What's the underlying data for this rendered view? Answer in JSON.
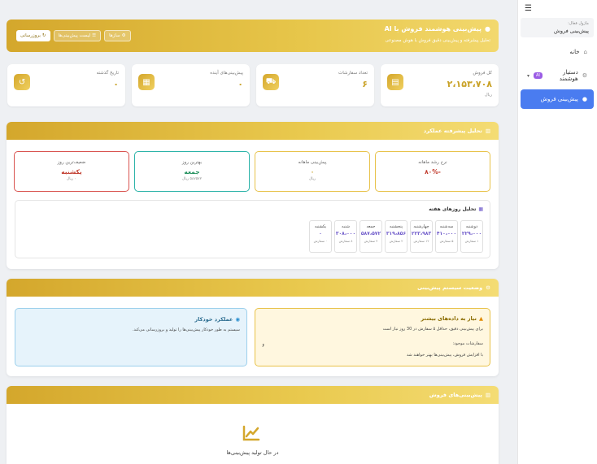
{
  "sidebar": {
    "menu_icon": "☰",
    "crumb_label": "ماژول فعال:",
    "crumb_value": "پیش‌بینی فروش",
    "items": [
      {
        "label": "خانه",
        "icon": "home-icon"
      },
      {
        "label": "دستیار هوشمند",
        "badge": "AI",
        "icon": "gear-icon"
      },
      {
        "label": "پیش‌بینی فروش",
        "icon": "lightbulb-icon"
      }
    ]
  },
  "hero": {
    "title": "پیش‌بینی هوشمند فروش با AI",
    "subtitle": "تحلیل پیشرفته و پیش‌بینی دقیق فروش با هوش مصنوعی",
    "buttons": {
      "refresh": "بروزرسانی",
      "list": "لیست پیش‌بینی‌ها",
      "settings": "سازها"
    }
  },
  "stats": [
    {
      "label": "کل فروش",
      "value": "۲،۱۵۳،۷۰۸",
      "unit": "ریال",
      "icon": "money-icon"
    },
    {
      "label": "تعداد سفارشات",
      "value": "۶",
      "unit": "",
      "icon": "cart-icon"
    },
    {
      "label": "پیش‌بینی‌های آینده",
      "value": "۰",
      "unit": "",
      "icon": "calendar-icon"
    },
    {
      "label": "تاریخ گذشته",
      "value": "۰",
      "unit": "",
      "icon": "history-icon"
    }
  ],
  "analysis": {
    "title": "تحلیل پیشرفته عملکرد",
    "cards": [
      {
        "label": "نرخ رشد ماهانه",
        "value": "-۸۰%",
        "sub": "",
        "color": "#c0392b",
        "border": "#e8c24a"
      },
      {
        "label": "پیش‌بینی ماهانه",
        "value": "۰",
        "sub": "ریال",
        "color": "#c9a227",
        "border": "#e8c24a"
      },
      {
        "label": "بهترین روز",
        "value": "جمعه",
        "sub": "۵۸۷۵۷۲ ریال",
        "color": "#1e8e5a",
        "border": "#2bb3a8"
      },
      {
        "label": "ضعیف‌ترین روز",
        "value": "یکشنبه",
        "sub": "۰ ریال",
        "color": "#c0392b",
        "border": "#d9534f"
      }
    ],
    "week_title": "تحلیل روزهای هفته",
    "days": [
      {
        "name": "دوشنبه",
        "value": "۲۲۹،۰۰۰",
        "orders": "۱ سفارش"
      },
      {
        "name": "سه‌شنبه",
        "value": "۴۱۰،۰۰۰",
        "orders": "۵ سفارش"
      },
      {
        "name": "چهارشنبه",
        "value": "۲۲۳،۹۸۳",
        "orders": "۱۲ سفارش"
      },
      {
        "name": "پنجشنبه",
        "value": "۳۱۹،۸۵۶",
        "orders": "۲ سفارش"
      },
      {
        "name": "جمعه",
        "value": "۵۸۷،۵۷۲",
        "orders": "۴ سفارش"
      },
      {
        "name": "شنبه",
        "value": "۳۰۸،۰۰۰",
        "orders": "۸ سفارش"
      },
      {
        "name": "یکشنبه",
        "value": "۰",
        "orders": "۰ سفارش"
      }
    ]
  },
  "system": {
    "title": "وضعیت سیستم پیش‌بینی",
    "warn_title": "نیاز به داده‌های بیشتر",
    "warn_line1": "برای پیش‌بینی دقیق، حداقل ۵ سفارش در 30 روز نیاز است",
    "warn_line2": "سفارشات موجود:",
    "warn_count": "۶",
    "warn_line3": "با افزایش فروش، پیش‌بینی‌ها بهتر خواهند شد",
    "auto_title": "عملکرد خودکار",
    "auto_desc": "سیستم به طور خودکار پیش‌بینی‌ها را تولید و بروزرسانی می‌کند."
  },
  "forecasts": {
    "title": "پیش‌بینی‌های فروش",
    "loading": "در حال تولید پیش‌بینی‌ها"
  }
}
